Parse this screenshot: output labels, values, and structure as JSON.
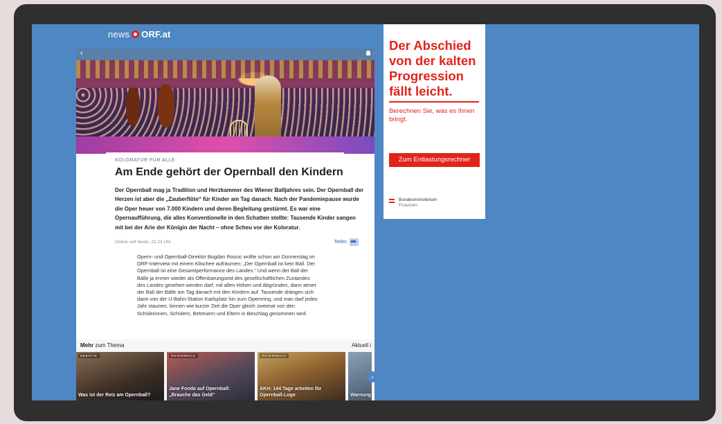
{
  "site": {
    "brand_news": "news",
    "brand_orf": "ORF.at"
  },
  "article": {
    "kicker": "KOLORATUR FÜR ALLE",
    "headline": "Am Ende gehört der Opernball den Kindern",
    "lead": "Der Opernball mag ja Tradition und Herzkammer des Wiener Balljahres sein. Der Opernball der Herzen ist aber die „Zauberflöte“ für Kinder am Tag danach. Nach der Pandemiepause wurde die Oper heuer von 7.000 Kindern und deren Begleitung gestürmt. Es war eine Opernaufführung, die alles Konventionelle in den Schatten stellte: Tausende Kinder sangen mit bei der Arie der Königin der Nacht – ohne Scheu vor der Koloratur.",
    "published": "Online seit heute, 21.23 Uhr",
    "share_label": "Teilen",
    "body": "Opern- und Opernball-Direktor Bogdan Roscic wollte schon am Donnerstag im ORF-Interview mit einem Klischee aufräumen: „Der Opernball ist kein Ball. Der Opernball ist eine Gesamtperformance des Landes.“ Und wenn der Ball der Bälle ja immer wieder als Offenbarungseid des gesellschaftlichen Zustandes des Landes gesehen werden darf, mit allen Höhen und Abgründen, dann atmet der Ball der Bälle am Tag danach mit den Kindern auf. Tausende drängen sich dann von der U-Bahn-Station Karlsplatz hin zum Opernring, und man darf jedes Jahr staunen, binnen wie kurzer Zeit die Oper gleich zweimal von den Schülerinnen, Schülern, Betreuern und Eltern in Beschlag genommen wird."
  },
  "more": {
    "title_bold": "Mehr",
    "title_rest": " zum Thema",
    "aktuell": "Aktuell i",
    "tiles": [
      {
        "tag": "DEBATTE",
        "caption": "Was ist der Reiz am Opernball?"
      },
      {
        "tag": "ÖSTERREICH",
        "caption": "Jane Fonda auf Opernball: „Brauche das Geld“"
      },
      {
        "tag": "ÖSTERREICH",
        "caption": "AKH: 144 Tage arbeiten für Opernball-Loge"
      },
      {
        "tag": "",
        "caption": "Warnung in der Tü"
      }
    ]
  },
  "ad": {
    "headline": "Der Abschied von der kalten Progression fällt leicht.",
    "subline": "Berechnen Sie, was es Ihnen bringt.",
    "button": "Zum Entlastungsrechner",
    "ministry_line1": "Bundesministerium",
    "ministry_line2": "Finanzen"
  },
  "colors": {
    "screen_bg": "#4f86c4",
    "ad_red": "#e2231a",
    "orf_red": "#d9261c"
  }
}
